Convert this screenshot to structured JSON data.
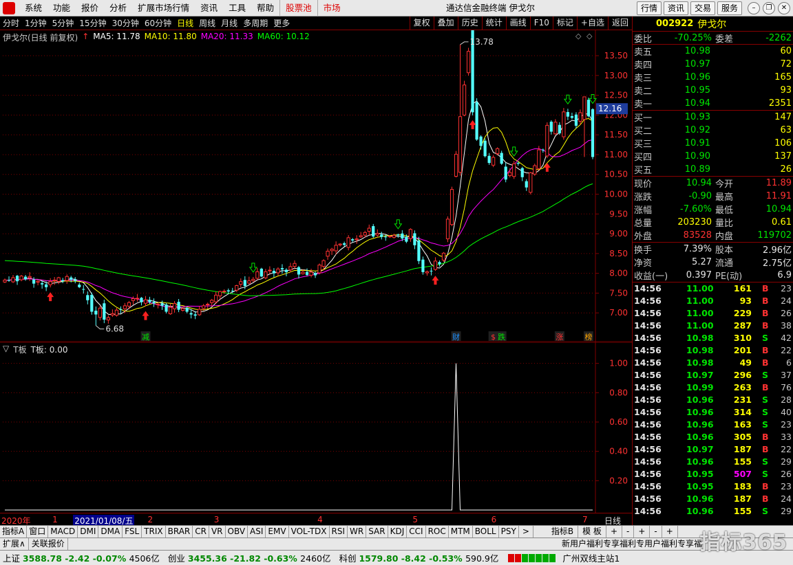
{
  "menubar": {
    "logo": "",
    "items": [
      "系统",
      "功能",
      "报价",
      "分析",
      "扩展市场行情",
      "资讯",
      "工具",
      "帮助"
    ],
    "red_items": [
      "股票池",
      "市场"
    ],
    "title": "通达信金融终端  伊戈尔",
    "right_buttons": [
      "行情",
      "资讯",
      "交易",
      "服务"
    ]
  },
  "toolbar": {
    "periods": [
      "分时",
      "1分钟",
      "5分钟",
      "15分钟",
      "30分钟",
      "60分钟",
      "日线",
      "周线",
      "月线",
      "多周期",
      "更多"
    ],
    "active_period": "日线",
    "tools": [
      "复权",
      "叠加",
      "历史",
      "统计",
      "画线",
      "F10",
      "标记",
      "+自选",
      "返回"
    ]
  },
  "chart_legend": {
    "title": "伊戈尔(日线 前复权)",
    "ma5": "MA5: 11.78",
    "ma10": "MA10: 11.80",
    "ma20": "MA20: 11.33",
    "ma60": "MA60: 10.12"
  },
  "sub_legend": {
    "name": "T板",
    "value": "T板: 0.00"
  },
  "colors": {
    "up": "#ff3232",
    "down": "#54ffff",
    "ma5": "#ffffff",
    "ma10": "#ffff00",
    "ma20": "#ff00ff",
    "ma60": "#00ff00",
    "grid": "#800000"
  },
  "chart_data": [
    {
      "type": "candlestick",
      "title": "伊戈尔(日线 前复权)",
      "ylim": [
        6.5,
        13.9
      ],
      "y_ticks": [
        7.0,
        7.5,
        8.0,
        8.5,
        9.0,
        9.5,
        10.0,
        10.5,
        11.0,
        11.5,
        12.0,
        12.5,
        13.0,
        13.5
      ],
      "current_price": "12.16",
      "annotations": {
        "high": "13.78",
        "low": "6.68"
      },
      "event_labels": [
        "减",
        "财",
        "$",
        "跌",
        "涨",
        "榜"
      ],
      "close": [
        7.83,
        7.82,
        7.89,
        7.8,
        7.93,
        7.85,
        7.92,
        7.74,
        7.8,
        7.72,
        7.65,
        7.79,
        7.83,
        7.89,
        7.8,
        7.92,
        7.84,
        7.81,
        7.65,
        7.59,
        7.32,
        7.03,
        6.96,
        7.12,
        6.83,
        6.88,
        6.98,
        7.07,
        7.09,
        7.18,
        7.26,
        7.36,
        7.37,
        7.27,
        7.33,
        7.27,
        7.24,
        7.22,
        7.18,
        7.03,
        7.14,
        7.24,
        7.08,
        7.11,
        7.03,
        6.96,
        6.93,
        7.09,
        7.18,
        7.22,
        7.32,
        7.45,
        7.54,
        7.55,
        7.54,
        7.56,
        7.69,
        7.79,
        7.68,
        7.81,
        7.85,
        8.04,
        7.92,
        8.04,
        8.08,
        8.0,
        8.11,
        8.1,
        8.03,
        8.17,
        8.25,
        7.97,
        8.03,
        7.96,
        8.03,
        7.95,
        8.21,
        8.32,
        8.56,
        8.61,
        8.71,
        8.74,
        8.72,
        8.9,
        8.83,
        8.87,
        8.95,
        9.03,
        9.14,
        8.93,
        9.01,
        8.92,
        8.91,
        8.94,
        8.96,
        8.96,
        8.88,
        8.8,
        9.11,
        8.71,
        8.31,
        8.03,
        8.04,
        8.05,
        8.31,
        8.23,
        8.51,
        9.37,
        10.12,
        11.01,
        11.96,
        12.76,
        13.61,
        12.07,
        11.38,
        11.22,
        10.96,
        10.79,
        10.93,
        11.15,
        10.77,
        10.37,
        10.55,
        10.77,
        10.77,
        10.43,
        10.17,
        10.54,
        10.72,
        11.12,
        11.12,
        11.74,
        11.58,
        11.82,
        11.54,
        12.08,
        11.96,
        11.93,
        11.73,
        12.06,
        12.46,
        11.97,
        10.94
      ]
    },
    {
      "type": "line",
      "title": "T板",
      "ylim": [
        0,
        1.05
      ],
      "y_ticks": [
        0.2,
        0.4,
        0.6,
        0.8,
        1.0
      ],
      "spike_index": 109,
      "spike_value": 1.0
    }
  ],
  "quote": {
    "code": "002922",
    "name": "伊戈尔",
    "weibi_label": "委比",
    "weibi": "-70.25%",
    "weicha_label": "委差",
    "weicha": "-2262",
    "asks": [
      {
        "label": "卖五",
        "price": "10.98",
        "vol": "60"
      },
      {
        "label": "卖四",
        "price": "10.97",
        "vol": "72"
      },
      {
        "label": "卖三",
        "price": "10.96",
        "vol": "165"
      },
      {
        "label": "卖二",
        "price": "10.95",
        "vol": "93"
      },
      {
        "label": "卖一",
        "price": "10.94",
        "vol": "2351"
      }
    ],
    "bids": [
      {
        "label": "买一",
        "price": "10.93",
        "vol": "147"
      },
      {
        "label": "买二",
        "price": "10.92",
        "vol": "63"
      },
      {
        "label": "买三",
        "price": "10.91",
        "vol": "106"
      },
      {
        "label": "买四",
        "price": "10.90",
        "vol": "137"
      },
      {
        "label": "买五",
        "price": "10.89",
        "vol": "26"
      }
    ],
    "stats": [
      {
        "l1": "现价",
        "v1": "10.94",
        "c1": "g",
        "l2": "今开",
        "v2": "11.89",
        "c2": "r"
      },
      {
        "l1": "涨跌",
        "v1": "-0.90",
        "c1": "g",
        "l2": "最高",
        "v2": "11.91",
        "c2": "r"
      },
      {
        "l1": "涨幅",
        "v1": "-7.60%",
        "c1": "g",
        "l2": "最低",
        "v2": "10.94",
        "c2": "g"
      },
      {
        "l1": "总量",
        "v1": "203230",
        "c1": "y",
        "l2": "量比",
        "v2": "0.61",
        "c2": "y"
      },
      {
        "l1": "外盘",
        "v1": "83528",
        "c1": "r",
        "l2": "内盘",
        "v2": "119702",
        "c2": "g"
      }
    ],
    "stats2": [
      {
        "l1": "换手",
        "v1": "7.39%",
        "c1": "w",
        "l2": "股本",
        "v2": "2.96亿",
        "c2": "w"
      },
      {
        "l1": "净资",
        "v1": "5.27",
        "c1": "w",
        "l2": "流通",
        "v2": "2.75亿",
        "c2": "w"
      },
      {
        "l1": "收益(一)",
        "v1": "0.397",
        "c1": "w",
        "l2": "PE(动)",
        "v2": "6.9",
        "c2": "w"
      }
    ],
    "ticks": [
      {
        "t": "14:56",
        "p": "11.00",
        "v": "161",
        "d": "B",
        "n": "23"
      },
      {
        "t": "14:56",
        "p": "11.00",
        "v": "93",
        "d": "B",
        "n": "24"
      },
      {
        "t": "14:56",
        "p": "11.00",
        "v": "229",
        "d": "B",
        "n": "26"
      },
      {
        "t": "14:56",
        "p": "11.00",
        "v": "287",
        "d": "B",
        "n": "38"
      },
      {
        "t": "14:56",
        "p": "10.98",
        "v": "310",
        "d": "S",
        "n": "42"
      },
      {
        "t": "14:56",
        "p": "10.98",
        "v": "201",
        "d": "B",
        "n": "22"
      },
      {
        "t": "14:56",
        "p": "10.98",
        "v": "49",
        "d": "B",
        "n": "6"
      },
      {
        "t": "14:56",
        "p": "10.97",
        "v": "296",
        "d": "S",
        "n": "37"
      },
      {
        "t": "14:56",
        "p": "10.99",
        "v": "263",
        "d": "B",
        "n": "76"
      },
      {
        "t": "14:56",
        "p": "10.96",
        "v": "231",
        "d": "S",
        "n": "28"
      },
      {
        "t": "14:56",
        "p": "10.96",
        "v": "314",
        "d": "S",
        "n": "40"
      },
      {
        "t": "14:56",
        "p": "10.96",
        "v": "163",
        "d": "S",
        "n": "23"
      },
      {
        "t": "14:56",
        "p": "10.96",
        "v": "305",
        "d": "B",
        "n": "33"
      },
      {
        "t": "14:56",
        "p": "10.97",
        "v": "187",
        "d": "B",
        "n": "22"
      },
      {
        "t": "14:56",
        "p": "10.96",
        "v": "155",
        "d": "S",
        "n": "29"
      },
      {
        "t": "14:56",
        "p": "10.95",
        "v": "507",
        "d": "S",
        "n": "26"
      },
      {
        "t": "14:56",
        "p": "10.95",
        "v": "183",
        "d": "B",
        "n": "23"
      },
      {
        "t": "14:56",
        "p": "10.96",
        "v": "187",
        "d": "B",
        "n": "24"
      },
      {
        "t": "14:56",
        "p": "10.96",
        "v": "155",
        "d": "S",
        "n": "29"
      }
    ]
  },
  "datestrip": {
    "labels": [
      {
        "text": "2020年",
        "i": 0
      },
      {
        "text": "1",
        "i": 12
      },
      {
        "text": "2021/01/08/五",
        "i": 17
      },
      {
        "text": "2",
        "i": 35
      },
      {
        "text": "3",
        "i": 51
      },
      {
        "text": "4",
        "i": 76
      },
      {
        "text": "5",
        "i": 99
      },
      {
        "text": "6",
        "i": 118
      },
      {
        "text": "7",
        "i": 140
      }
    ],
    "selected": "2021/01/08/五",
    "period_btn": "日线"
  },
  "indbar": {
    "items": [
      "指标A",
      "窗口",
      "MACD",
      "DMI",
      "DMA",
      "FSL",
      "TRIX",
      "BRAR",
      "CR",
      "VR",
      "OBV",
      "ASI",
      "EMV",
      "VOL-TDX",
      "RSI",
      "WR",
      "SAR",
      "KDJ",
      "CCI",
      "ROC",
      "MTM",
      "BOLL",
      "PSY",
      ">"
    ],
    "right_items": [
      "指标B",
      "模 板",
      "+",
      "-",
      "+",
      "-",
      "+"
    ]
  },
  "newsbar": {
    "items": [
      "扩展∧",
      "关联报价"
    ],
    "ticker": "新用户福利专享福利专用户福利专享福"
  },
  "statusbar": {
    "indices": [
      {
        "name": "上证",
        "price": "3588.78",
        "chg": "-2.42",
        "pct": "-0.07%",
        "amt": "4506亿"
      },
      {
        "name": "创业",
        "price": "3455.36",
        "chg": "-21.82",
        "pct": "-0.63%",
        "amt": "2460亿"
      },
      {
        "name": "科创",
        "price": "1579.80",
        "chg": "-8.42",
        "pct": "-0.53%",
        "amt": "590.9亿"
      }
    ],
    "site": "广州双线主站1"
  },
  "watermark": "指标365"
}
